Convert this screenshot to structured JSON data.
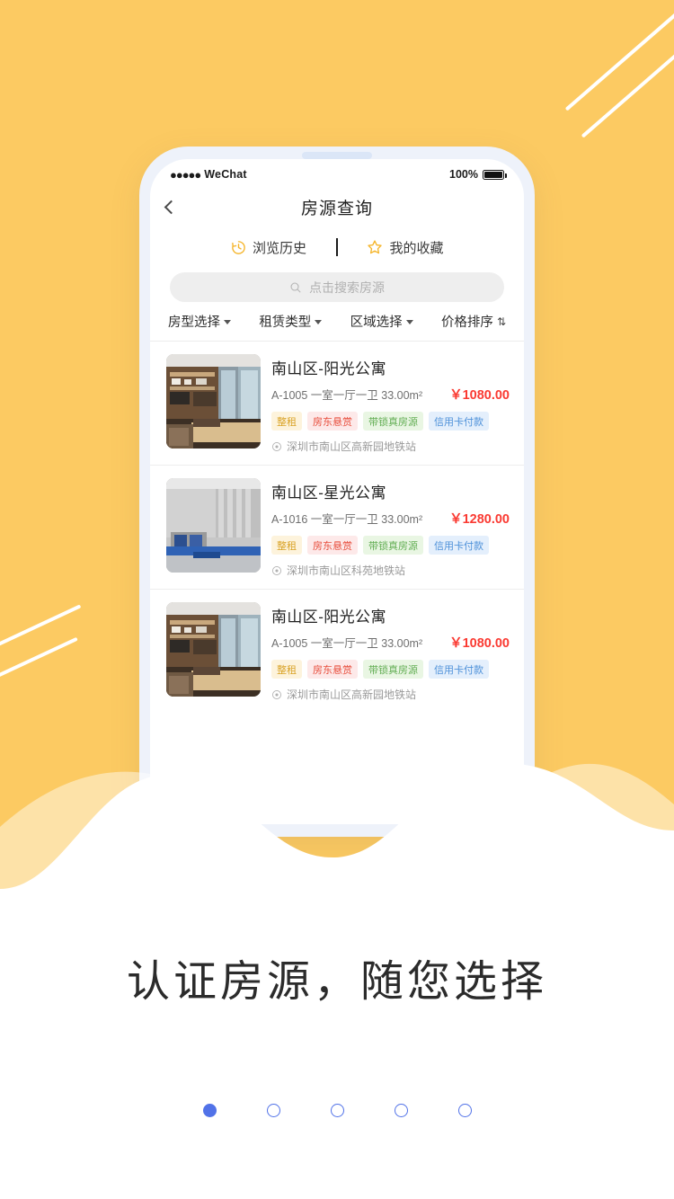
{
  "background": {
    "yellow": "#fcca62",
    "wave_color": "#ffffff",
    "deco_icon": "diagonal-lines"
  },
  "phone": {
    "frame_color": "#eef2fa",
    "status_bar": {
      "signal_dots": "●●●●●",
      "carrier": "WeChat",
      "battery_percent": "100%"
    },
    "nav": {
      "back_icon": "chevron-left-icon",
      "title": "房源查询"
    },
    "quick_links": [
      {
        "icon": "history-clock-icon",
        "label": "浏览历史"
      },
      {
        "icon": "star-outline-icon",
        "label": "我的收藏"
      }
    ],
    "search": {
      "icon": "search-icon",
      "placeholder": "点击搜索房源",
      "value": ""
    },
    "filters": [
      {
        "label": "房型选择",
        "icon": "chevron-down-icon"
      },
      {
        "label": "租赁类型",
        "icon": "chevron-down-icon"
      },
      {
        "label": "区域选择",
        "icon": "chevron-down-icon"
      },
      {
        "label": "价格排序",
        "icon": "sort-updown-icon"
      }
    ],
    "listings": [
      {
        "title": "南山区-阳光公寓",
        "spec": "A-1005 一室一厅一卫 33.00m²",
        "price": "￥1080.00",
        "tags": [
          {
            "label": "整租",
            "bg": "#fdf3dc",
            "color": "#d9a327"
          },
          {
            "label": "房东悬赏",
            "bg": "#fde9e9",
            "color": "#e8503f"
          },
          {
            "label": "带锁真房源",
            "bg": "#e9f6e3",
            "color": "#63ae54"
          },
          {
            "label": "信用卡付款",
            "bg": "#e4effc",
            "color": "#4e91d9"
          }
        ],
        "address_icon": "location-pin-icon",
        "address": "深圳市南山区高新园地铁站",
        "thumb": "room-photo-warm-wood"
      },
      {
        "title": "南山区-星光公寓",
        "spec": "A-1016 一室一厅一卫 33.00m²",
        "price": "￥1280.00",
        "tags": [
          {
            "label": "整租",
            "bg": "#fdf3dc",
            "color": "#d9a327"
          },
          {
            "label": "房东悬赏",
            "bg": "#fde9e9",
            "color": "#e8503f"
          },
          {
            "label": "带锁真房源",
            "bg": "#e9f6e3",
            "color": "#63ae54"
          },
          {
            "label": "信用卡付款",
            "bg": "#e4effc",
            "color": "#4e91d9"
          }
        ],
        "address_icon": "location-pin-icon",
        "address": "深圳市南山区科苑地铁站",
        "thumb": "room-photo-grey-blue"
      },
      {
        "title": "南山区-阳光公寓",
        "spec": "A-1005 一室一厅一卫 33.00m²",
        "price": "￥1080.00",
        "tags": [
          {
            "label": "整租",
            "bg": "#fdf3dc",
            "color": "#d9a327"
          },
          {
            "label": "房东悬赏",
            "bg": "#fde9e9",
            "color": "#e8503f"
          },
          {
            "label": "带锁真房源",
            "bg": "#e9f6e3",
            "color": "#63ae54"
          },
          {
            "label": "信用卡付款",
            "bg": "#e4effc",
            "color": "#4e91d9"
          }
        ],
        "address_icon": "location-pin-icon",
        "address": "深圳市南山区高新园地铁站",
        "thumb": "room-photo-warm-wood"
      }
    ]
  },
  "headline": "认证房源，随您选择",
  "pager": {
    "count": 5,
    "active_index": 0,
    "active_color": "#5172e8"
  }
}
